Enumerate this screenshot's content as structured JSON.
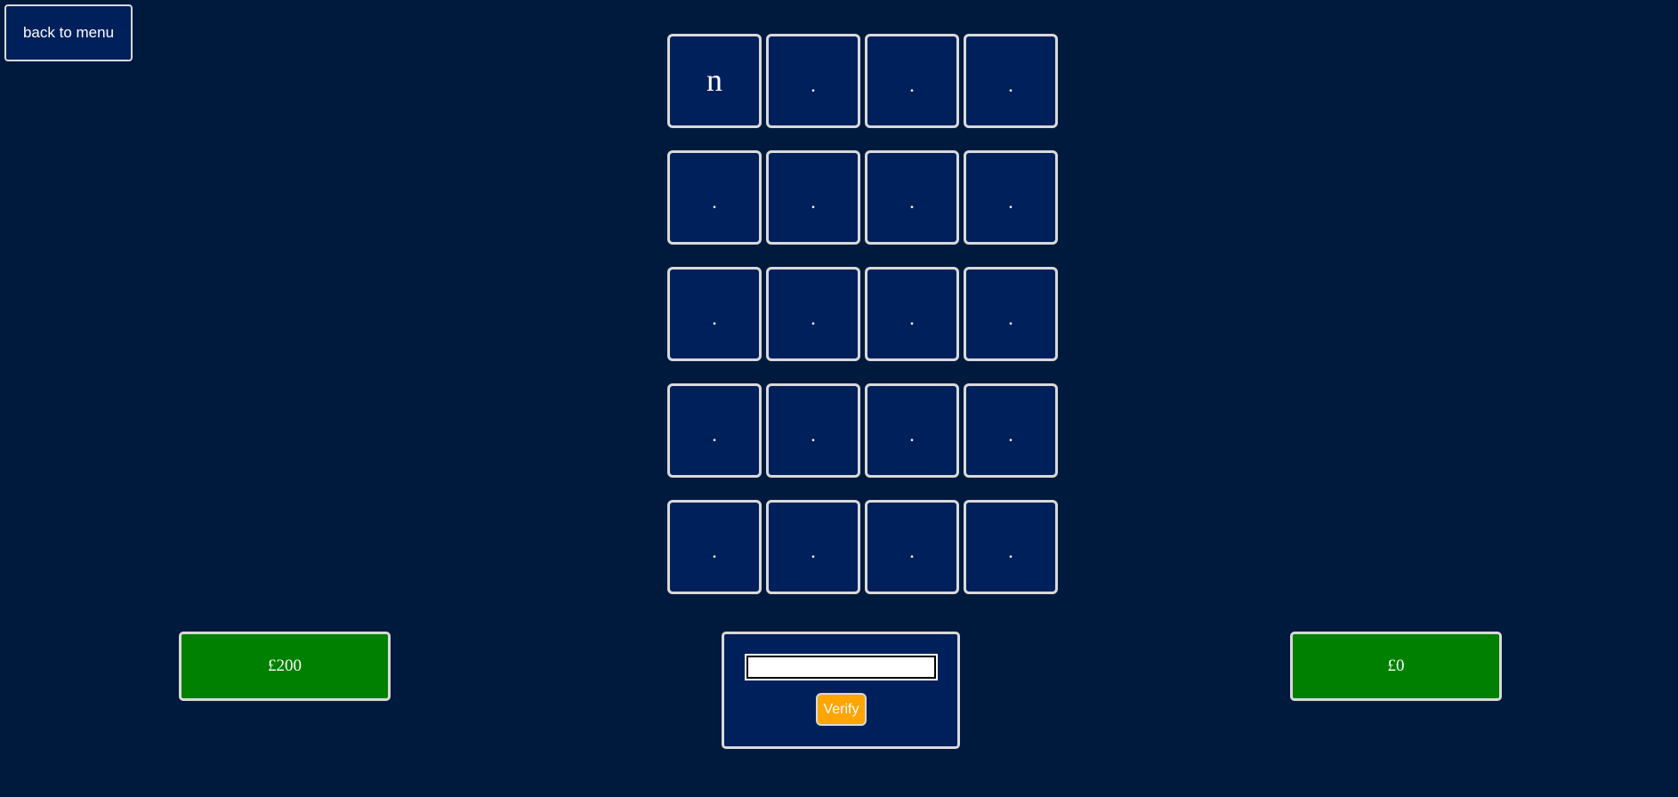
{
  "nav": {
    "back_label": "back to menu"
  },
  "board": {
    "tiles": [
      {
        "text": "n",
        "revealed": true
      },
      {
        "text": ".",
        "revealed": false
      },
      {
        "text": ".",
        "revealed": false
      },
      {
        "text": ".",
        "revealed": false
      },
      {
        "text": ".",
        "revealed": false
      },
      {
        "text": ".",
        "revealed": false
      },
      {
        "text": ".",
        "revealed": false
      },
      {
        "text": ".",
        "revealed": false
      },
      {
        "text": ".",
        "revealed": false
      },
      {
        "text": ".",
        "revealed": false
      },
      {
        "text": ".",
        "revealed": false
      },
      {
        "text": ".",
        "revealed": false
      },
      {
        "text": ".",
        "revealed": false
      },
      {
        "text": ".",
        "revealed": false
      },
      {
        "text": ".",
        "revealed": false
      },
      {
        "text": ".",
        "revealed": false
      },
      {
        "text": ".",
        "revealed": false
      },
      {
        "text": ".",
        "revealed": false
      },
      {
        "text": ".",
        "revealed": false
      },
      {
        "text": ".",
        "revealed": false
      }
    ]
  },
  "scores": {
    "left": "£200",
    "right": "£0"
  },
  "answer": {
    "value": "",
    "placeholder": "",
    "verify_label": "Verify"
  },
  "colors": {
    "background": "#001a3d",
    "tile": "#00205b",
    "border": "#d9d9d9",
    "score": "#008000",
    "verify": "#ffa500"
  }
}
